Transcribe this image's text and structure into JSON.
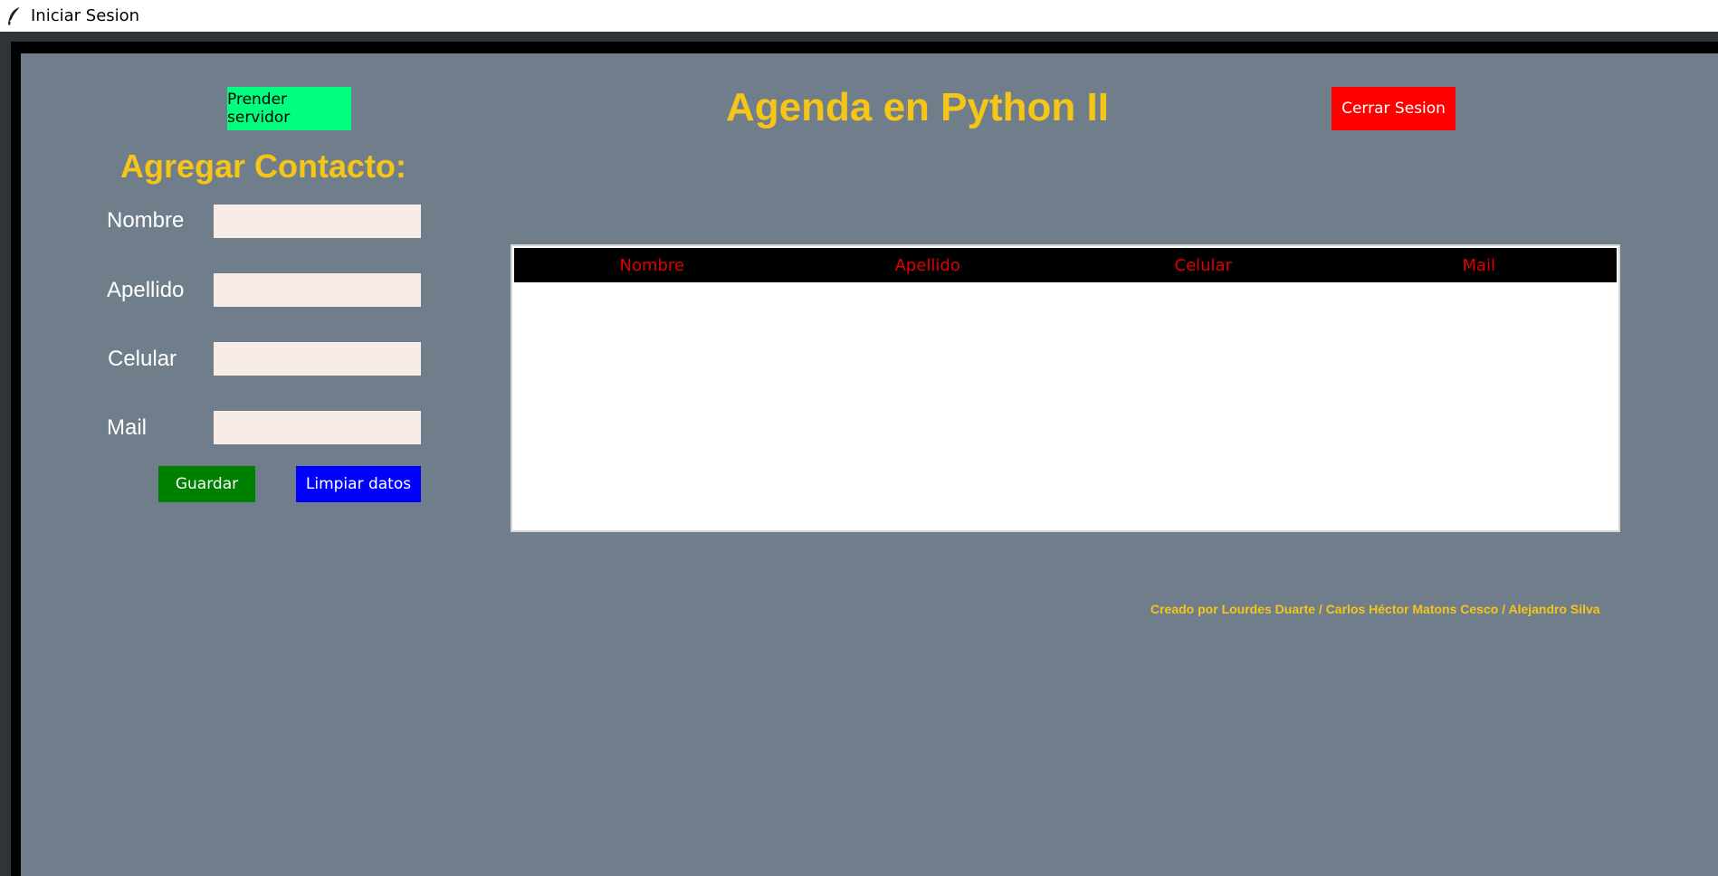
{
  "window": {
    "title": "Iniciar Sesion",
    "icon": "feather-icon"
  },
  "header": {
    "start_server_label": "Prender servidor",
    "app_title": "Agenda en Python II",
    "logout_label": "Cerrar Sesion"
  },
  "form": {
    "heading": "Agregar Contacto:",
    "fields": [
      {
        "label": "Nombre",
        "value": ""
      },
      {
        "label": "Apellido",
        "value": ""
      },
      {
        "label": "Celular",
        "value": ""
      },
      {
        "label": "Mail",
        "value": ""
      }
    ],
    "save_label": "Guardar",
    "clear_label": "Limpiar datos"
  },
  "table": {
    "columns": [
      "Nombre",
      "Apellido",
      "Celular",
      "Mail"
    ],
    "rows": []
  },
  "footer": {
    "credits": "Creado por Lourdes Duarte / Carlos Héctor Matons Cesco / Alejandro Silva"
  },
  "colors": {
    "background": "#707e8c",
    "accent_yellow": "#f5c518",
    "start_server_button": "#00ff7f",
    "logout_button": "#ff0000",
    "save_button": "#008000",
    "clear_button": "#0000ff",
    "table_header_bg": "#000000",
    "table_header_text": "#e10000",
    "input_bg": "#f8ede6"
  }
}
